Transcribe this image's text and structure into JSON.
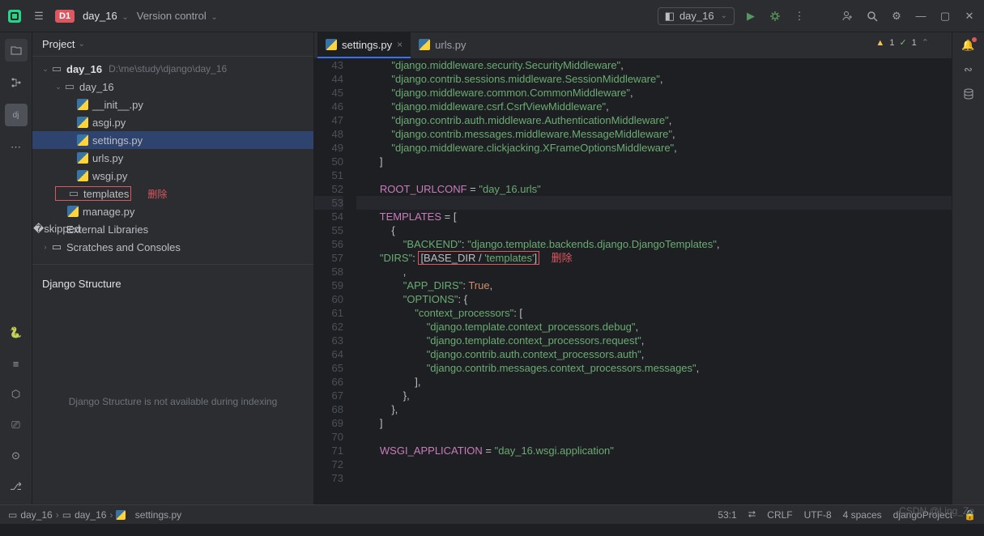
{
  "titlebar": {
    "project_badge": "D1",
    "project_name": "day_16",
    "vcs_label": "Version control",
    "run_config": "day_16"
  },
  "project_panel": {
    "title": "Project",
    "root": {
      "name": "day_16",
      "path": "D:\\me\\study\\django\\day_16"
    },
    "app_dir": "day_16",
    "files": [
      "__init__.py",
      "asgi.py",
      "settings.py",
      "urls.py",
      "wsgi.py"
    ],
    "templates_dir": "templates",
    "templates_annotation": "删除",
    "manage": "manage.py",
    "ext_lib": "External Libraries",
    "scratches": "Scratches and Consoles"
  },
  "django_structure": {
    "title": "Django Structure",
    "placeholder": "Django Structure is not available during indexing"
  },
  "editor": {
    "tabs": [
      {
        "name": "settings.py",
        "active": true
      },
      {
        "name": "urls.py",
        "active": false
      }
    ],
    "warnings_yellow": "1",
    "warnings_green": "1",
    "line_start": 43,
    "line_end": 73,
    "highlight_line": 53,
    "annotation_inline": "删除",
    "code_lines": [
      {
        "n": 43,
        "t": "            \"django.middleware.security.SecurityMiddleware\","
      },
      {
        "n": 44,
        "t": "            \"django.contrib.sessions.middleware.SessionMiddleware\","
      },
      {
        "n": 45,
        "t": "            \"django.middleware.common.CommonMiddleware\","
      },
      {
        "n": 46,
        "t": "            \"django.middleware.csrf.CsrfViewMiddleware\","
      },
      {
        "n": 47,
        "t": "            \"django.contrib.auth.middleware.AuthenticationMiddleware\","
      },
      {
        "n": 48,
        "t": "            \"django.contrib.messages.middleware.MessageMiddleware\","
      },
      {
        "n": 49,
        "t": "            \"django.middleware.clickjacking.XFrameOptionsMiddleware\","
      },
      {
        "n": 50,
        "t": "        ]"
      },
      {
        "n": 51,
        "t": ""
      },
      {
        "n": 52,
        "t": "        ROOT_URLCONF = \"day_16.urls\""
      },
      {
        "n": 53,
        "t": ""
      },
      {
        "n": 54,
        "t": "        TEMPLATES = ["
      },
      {
        "n": 55,
        "t": "            {"
      },
      {
        "n": 56,
        "t": "                \"BACKEND\": \"django.template.backends.django.DjangoTemplates\","
      },
      {
        "n": 57,
        "t": "                \"DIRS\": [BASE_DIR / 'templates']"
      },
      {
        "n": 58,
        "t": "                ,"
      },
      {
        "n": 59,
        "t": "                \"APP_DIRS\": True,"
      },
      {
        "n": 60,
        "t": "                \"OPTIONS\": {"
      },
      {
        "n": 61,
        "t": "                    \"context_processors\": ["
      },
      {
        "n": 62,
        "t": "                        \"django.template.context_processors.debug\","
      },
      {
        "n": 63,
        "t": "                        \"django.template.context_processors.request\","
      },
      {
        "n": 64,
        "t": "                        \"django.contrib.auth.context_processors.auth\","
      },
      {
        "n": 65,
        "t": "                        \"django.contrib.messages.context_processors.messages\","
      },
      {
        "n": 66,
        "t": "                    ],"
      },
      {
        "n": 67,
        "t": "                },"
      },
      {
        "n": 68,
        "t": "            },"
      },
      {
        "n": 69,
        "t": "        ]"
      },
      {
        "n": 70,
        "t": ""
      },
      {
        "n": 71,
        "t": "        WSGI_APPLICATION = \"day_16.wsgi.application\""
      },
      {
        "n": 72,
        "t": ""
      },
      {
        "n": 73,
        "t": ""
      }
    ]
  },
  "status": {
    "crumbs": [
      "day_16",
      "day_16",
      "settings.py"
    ],
    "position": "53:1",
    "line_sep": "CRLF",
    "encoding": "UTF-8",
    "indent": "4 spaces",
    "interpreter": "djangoProject"
  },
  "watermark": "CSDN @Ling_Ze"
}
